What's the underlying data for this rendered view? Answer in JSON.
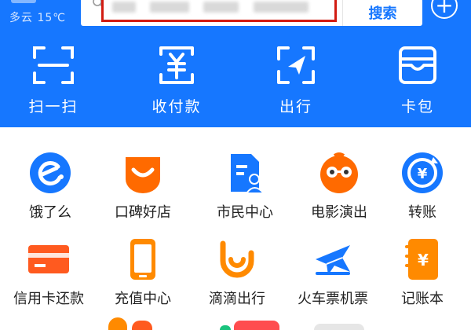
{
  "header": {
    "weather": "多云 15℃",
    "search": {
      "button_label": "搜索"
    },
    "add_button": "+"
  },
  "quick_actions": [
    {
      "label": "扫一扫",
      "icon": "scan-icon"
    },
    {
      "label": "收付款",
      "icon": "pay-receive-icon"
    },
    {
      "label": "出行",
      "icon": "travel-icon"
    },
    {
      "label": "卡包",
      "icon": "card-wallet-icon"
    }
  ],
  "apps": [
    {
      "label": "饿了么",
      "icon": "eleme-icon",
      "color": "#1677ff"
    },
    {
      "label": "口碑好店",
      "icon": "koubei-icon",
      "color": "#ff6a00"
    },
    {
      "label": "市民中心",
      "icon": "citizen-center-icon",
      "color": "#1677ff"
    },
    {
      "label": "电影演出",
      "icon": "movie-show-icon",
      "color": "#ff6a00"
    },
    {
      "label": "转账",
      "icon": "transfer-icon",
      "color": "#1677ff"
    },
    {
      "label": "信用卡还款",
      "icon": "credit-card-icon",
      "color": "#ff5a1f"
    },
    {
      "label": "充值中心",
      "icon": "recharge-icon",
      "color": "#ff8a00"
    },
    {
      "label": "滴滴出行",
      "icon": "didi-icon",
      "color": "#ff8a00"
    },
    {
      "label": "火车票机票",
      "icon": "train-plane-icon",
      "color": "#1677ff"
    },
    {
      "label": "记账本",
      "icon": "ledger-icon",
      "color": "#ff8a00"
    }
  ],
  "colors": {
    "brand": "#1677ff",
    "highlight_box": "#d21c12"
  }
}
